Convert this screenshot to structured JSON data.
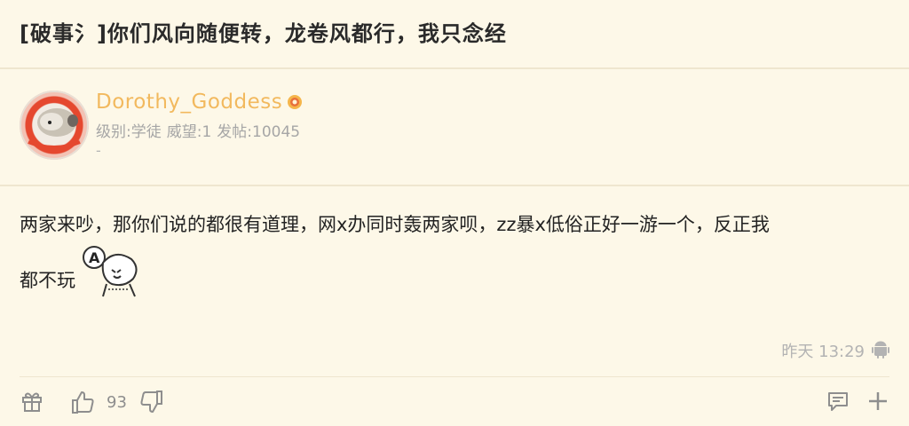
{
  "thread": {
    "title": "[破事氵]你们风向随便转，龙卷风都行，我只念经"
  },
  "author": {
    "username": "Dorothy_Goddess",
    "level": "级别:学徒",
    "prestige": "威望:1",
    "posts": "发帖:10045",
    "signature": "-"
  },
  "post": {
    "line1": "两家来吵，那你们说的都很有道理，网x办同时轰两家呗，zz暴x低俗正好一游一个，反正我",
    "line2": "都不玩",
    "timestamp": "昨天 13:29"
  },
  "toolbar": {
    "like_count": "93"
  },
  "colors": {
    "background": "#fdf8e8",
    "username": "#f2b95e",
    "meta": "#a6a6a6"
  },
  "icons": [
    "gift-icon",
    "thumbs-up-icon",
    "thumbs-down-icon",
    "comment-icon",
    "plus-icon",
    "android-icon",
    "medal-icon"
  ]
}
